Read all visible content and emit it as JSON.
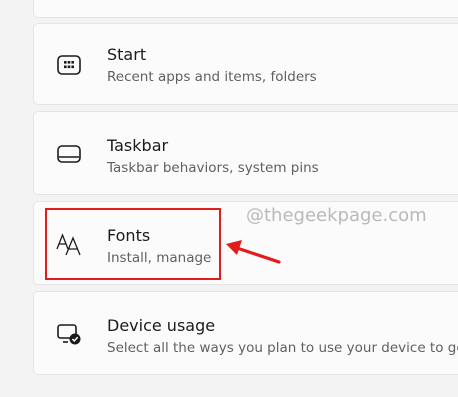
{
  "settings": {
    "items": [
      {
        "title": "Start",
        "description": "Recent apps and items, folders",
        "icon": "start-menu-icon"
      },
      {
        "title": "Taskbar",
        "description": "Taskbar behaviors, system pins",
        "icon": "taskbar-icon"
      },
      {
        "title": "Fonts",
        "description": "Install, manage",
        "icon": "fonts-icon"
      },
      {
        "title": "Device usage",
        "description": "Select all the ways you plan to use your device to ge",
        "icon": "device-usage-icon"
      }
    ]
  },
  "annotation": {
    "watermark": "@thegeekpage.com",
    "highlight_color": "#e21b1b",
    "highlighted_item": "Fonts"
  },
  "colors": {
    "background": "#f3f3f3",
    "card": "#fbfbfb",
    "title": "#1b1b1b",
    "description": "#606060"
  }
}
